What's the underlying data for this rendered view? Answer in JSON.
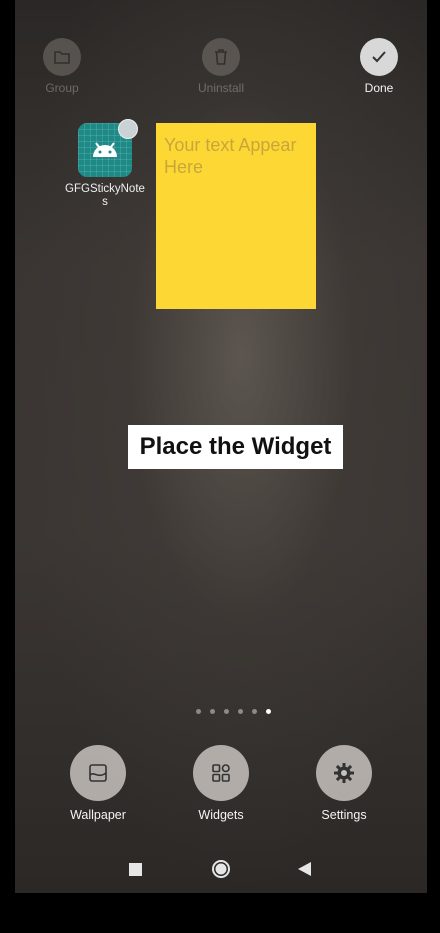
{
  "top_actions": {
    "group": {
      "label": "Group",
      "icon": "folder-icon"
    },
    "uninstall": {
      "label": "Uninstall",
      "icon": "trash-icon"
    },
    "done": {
      "label": "Done",
      "icon": "check-icon"
    }
  },
  "app": {
    "name": "GFGStickyNotes",
    "icon": "android-icon"
  },
  "widget": {
    "text": "Your text Appear Here",
    "color": "#fdd835"
  },
  "caption": "Place the Widget",
  "page_indicator": {
    "count": 6,
    "active_index": 5
  },
  "bottom_actions": {
    "wallpaper": {
      "label": "Wallpaper",
      "icon": "wallpaper-icon"
    },
    "widgets": {
      "label": "Widgets",
      "icon": "widgets-icon"
    },
    "settings": {
      "label": "Settings",
      "icon": "gear-icon"
    }
  },
  "navigation": {
    "recents": "square-icon",
    "home": "circle-icon",
    "back": "triangle-back-icon"
  }
}
